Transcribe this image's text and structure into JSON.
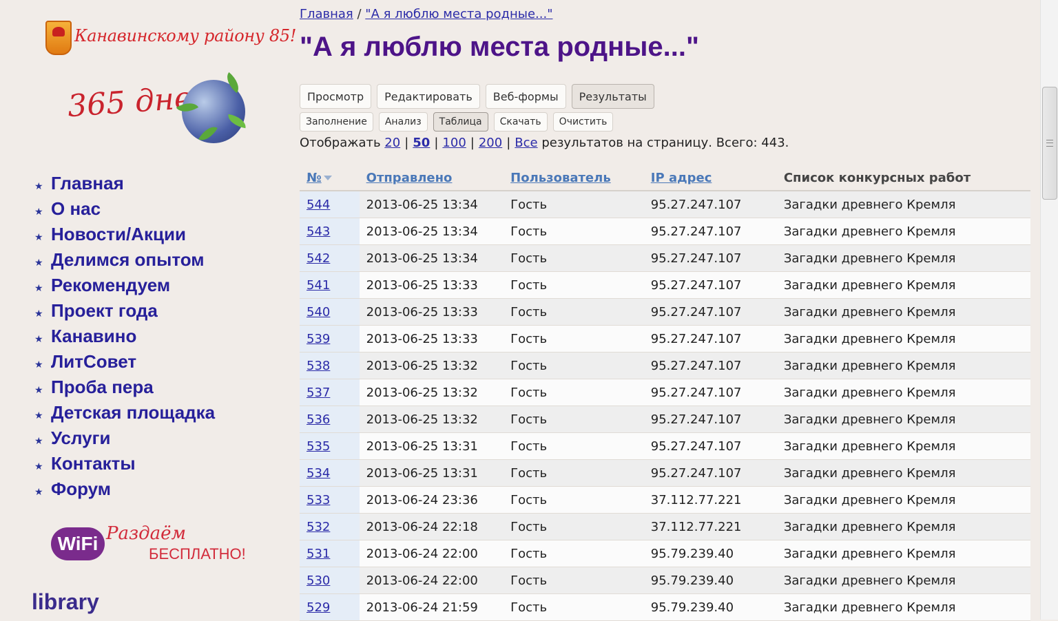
{
  "sidebar": {
    "logo85_text": "Канавинскому району 85!",
    "logo365_text": "365 дней",
    "nav": [
      {
        "label": "Главная"
      },
      {
        "label": "О нас"
      },
      {
        "label": "Новости/Акции"
      },
      {
        "label": "Делимся опытом"
      },
      {
        "label": "Рекомендуем"
      },
      {
        "label": "Проект года"
      },
      {
        "label": "Канавино"
      },
      {
        "label": "ЛитСовет"
      },
      {
        "label": "Проба пера"
      },
      {
        "label": "Детская площадка"
      },
      {
        "label": "Услуги"
      },
      {
        "label": "Контакты"
      },
      {
        "label": "Форум"
      }
    ],
    "wifi": {
      "badge": "WiFi",
      "script": "Раздаём",
      "free": "БЕСПЛАТНО!"
    },
    "library": "library"
  },
  "breadcrumb": {
    "home": "Главная",
    "sep": "/",
    "current": "\"А я люблю места родные...\""
  },
  "title": "\"А я люблю места родные...\"",
  "tabs_primary": [
    "Просмотр",
    "Редактировать",
    "Веб-формы",
    "Результаты"
  ],
  "tabs_primary_active": "Результаты",
  "tabs_secondary": [
    "Заполнение",
    "Анализ",
    "Таблица",
    "Скачать",
    "Очистить"
  ],
  "tabs_secondary_active": "Таблица",
  "pager": {
    "prefix": "Отображать",
    "options": [
      "20",
      "50",
      "100",
      "200",
      "Все"
    ],
    "selected": "50",
    "suffix": "результатов на страницу. Всего: 443."
  },
  "table": {
    "headers": [
      "№",
      "Отправлено",
      "Пользователь",
      "IP адрес",
      "Список конкурсных работ"
    ],
    "rows": [
      [
        "544",
        "2013-06-25 13:34",
        "Гость",
        "95.27.247.107",
        "Загадки древнего Кремля"
      ],
      [
        "543",
        "2013-06-25 13:34",
        "Гость",
        "95.27.247.107",
        "Загадки древнего Кремля"
      ],
      [
        "542",
        "2013-06-25 13:34",
        "Гость",
        "95.27.247.107",
        "Загадки древнего Кремля"
      ],
      [
        "541",
        "2013-06-25 13:33",
        "Гость",
        "95.27.247.107",
        "Загадки древнего Кремля"
      ],
      [
        "540",
        "2013-06-25 13:33",
        "Гость",
        "95.27.247.107",
        "Загадки древнего Кремля"
      ],
      [
        "539",
        "2013-06-25 13:33",
        "Гость",
        "95.27.247.107",
        "Загадки древнего Кремля"
      ],
      [
        "538",
        "2013-06-25 13:32",
        "Гость",
        "95.27.247.107",
        "Загадки древнего Кремля"
      ],
      [
        "537",
        "2013-06-25 13:32",
        "Гость",
        "95.27.247.107",
        "Загадки древнего Кремля"
      ],
      [
        "536",
        "2013-06-25 13:32",
        "Гость",
        "95.27.247.107",
        "Загадки древнего Кремля"
      ],
      [
        "535",
        "2013-06-25 13:31",
        "Гость",
        "95.27.247.107",
        "Загадки древнего Кремля"
      ],
      [
        "534",
        "2013-06-25 13:31",
        "Гость",
        "95.27.247.107",
        "Загадки древнего Кремля"
      ],
      [
        "533",
        "2013-06-24 23:36",
        "Гость",
        "37.112.77.221",
        "Загадки древнего Кремля"
      ],
      [
        "532",
        "2013-06-24 22:18",
        "Гость",
        "37.112.77.221",
        "Загадки древнего Кремля"
      ],
      [
        "531",
        "2013-06-24 22:00",
        "Гость",
        "95.79.239.40",
        "Загадки древнего Кремля"
      ],
      [
        "530",
        "2013-06-24 22:00",
        "Гость",
        "95.79.239.40",
        "Загадки древнего Кремля"
      ],
      [
        "529",
        "2013-06-24 21:59",
        "Гость",
        "95.79.239.40",
        "Загадки древнего Кремля"
      ]
    ]
  },
  "colors": {
    "title": "#4d1488",
    "nav": "#27209a",
    "link": "#2b2ba8"
  }
}
